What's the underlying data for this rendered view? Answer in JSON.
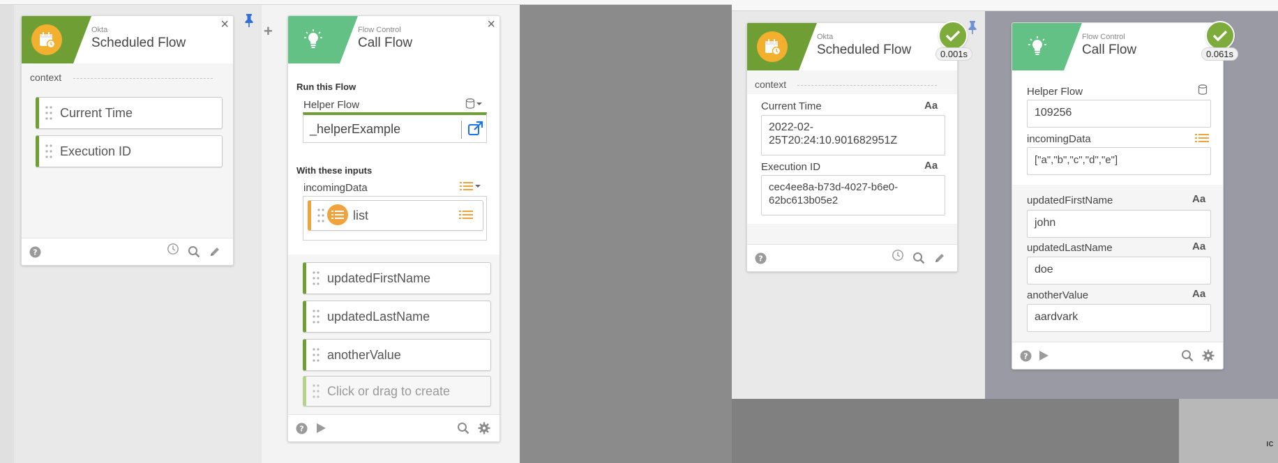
{
  "left": {
    "scheduled_card": {
      "category": "Okta",
      "title": "Scheduled Flow",
      "close": "×",
      "context_label": "context",
      "fields": [
        "Current Time",
        "Execution ID"
      ]
    },
    "add_button": "+",
    "call_card": {
      "category": "Flow Control",
      "title": "Call Flow",
      "close": "×",
      "run_label": "Run this Flow",
      "helper_label": "Helper Flow",
      "helper_value": "_helperExample",
      "inputs_label": "With these inputs",
      "incoming_label": "incomingData",
      "incoming_pill": "list",
      "outputs": [
        "updatedFirstName",
        "updatedLastName",
        "anotherValue"
      ],
      "create_placeholder": "Click or drag to create"
    }
  },
  "right": {
    "scheduled_card": {
      "category": "Okta",
      "title": "Scheduled Flow",
      "time": "0.001s",
      "context_label": "context",
      "current_time_label": "Current Time",
      "current_time_value_1": "2022-02-",
      "current_time_value_2": "25T20:24:10.901682951Z",
      "execution_id_label": "Execution ID",
      "execution_id_value_1": "cec4ee8a-b73d-4027-b6e0-",
      "execution_id_value_2": "62bc613b05e2",
      "type_marker": "Aa"
    },
    "call_card": {
      "category": "Flow Control",
      "title": "Call Flow",
      "time": "0.061s",
      "helper_label": "Helper Flow",
      "helper_value": "109256",
      "incoming_label": "incomingData",
      "incoming_value": "[\"a\",\"b\",\"c\",\"d\",\"e\"]",
      "outputs": [
        {
          "label": "updatedFirstName",
          "value": "john"
        },
        {
          "label": "updatedLastName",
          "value": "doe"
        },
        {
          "label": "anotherValue",
          "value": "aardvark"
        }
      ],
      "type_marker": "Aa"
    },
    "edge_text": "ıc"
  },
  "colors": {
    "okta_green": "#6f9e34",
    "flow_control_green": "#64c186",
    "calendar_orange": "#f3b02e",
    "list_orange": "#f0a23c",
    "success_green": "#7dab3c",
    "link_blue": "#1a73e8"
  }
}
